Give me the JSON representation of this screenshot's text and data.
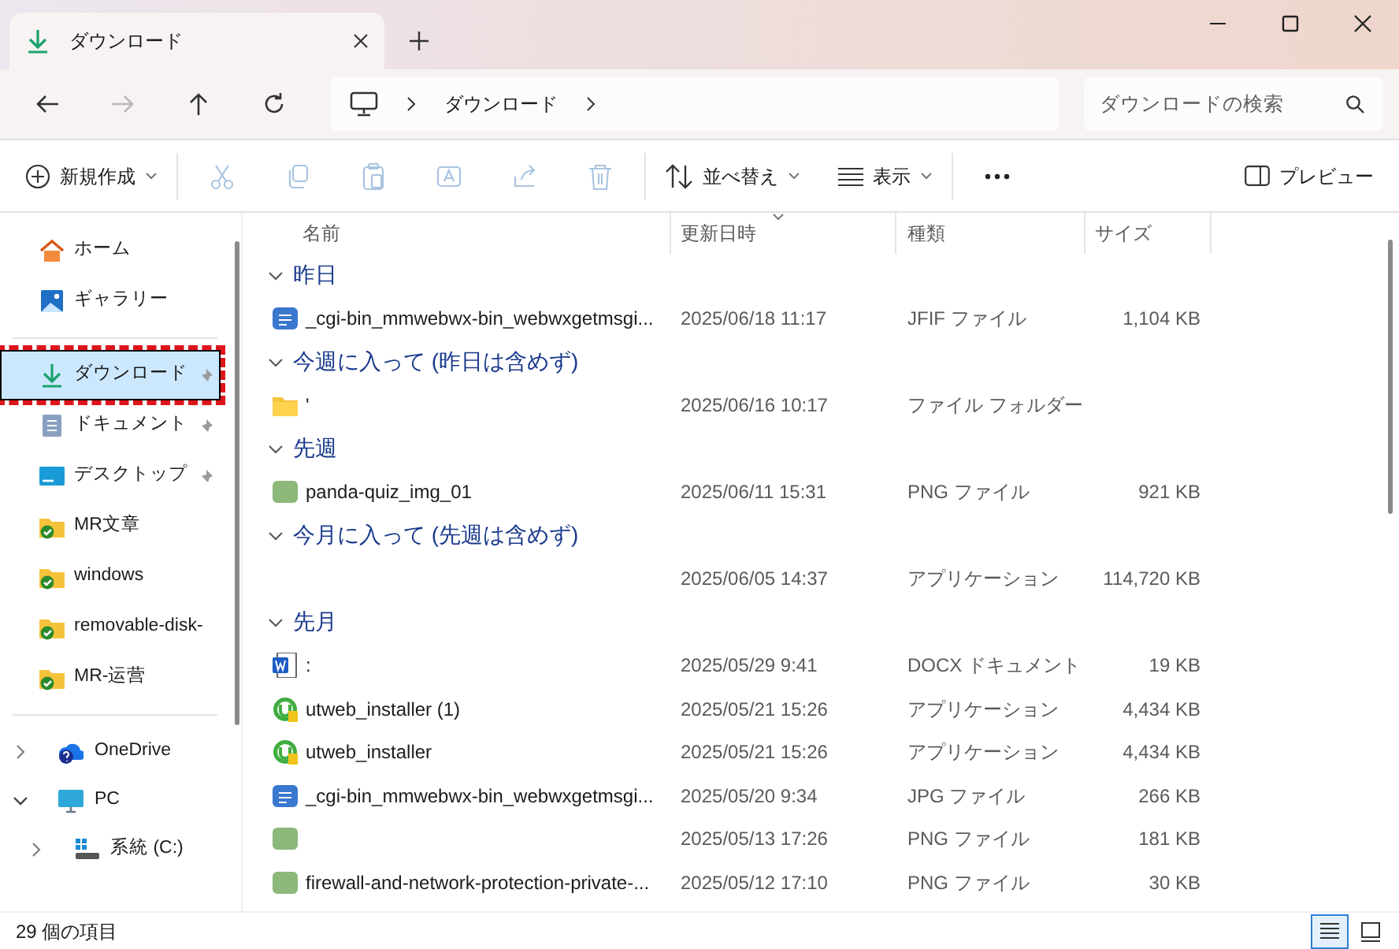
{
  "window": {
    "tab_title": "ダウンロード"
  },
  "address": {
    "crumbs": [
      "ダウンロード"
    ],
    "search_placeholder": "ダウンロードの検索"
  },
  "nav": [
    {
      "kind": "back",
      "disabled": false
    },
    {
      "kind": "forward",
      "disabled": true
    },
    {
      "kind": "up",
      "disabled": false
    },
    {
      "kind": "refresh",
      "disabled": false
    }
  ],
  "toolbar": {
    "new": "新規作成",
    "edit_tools": [
      {
        "kind": "cut",
        "disabled": true
      },
      {
        "kind": "copy",
        "disabled": true
      },
      {
        "kind": "paste",
        "disabled": true
      },
      {
        "kind": "rename",
        "disabled": true
      },
      {
        "kind": "share",
        "disabled": true
      },
      {
        "kind": "delete",
        "disabled": true
      }
    ],
    "sort": "並べ替え",
    "view": "表示",
    "preview": "プレビュー"
  },
  "sidebar": {
    "top": [
      {
        "label": "ホーム",
        "kind": "home",
        "pinned": false,
        "selected": false,
        "highlighted": false
      },
      {
        "label": "ギャラリー",
        "kind": "gallery",
        "pinned": false,
        "selected": false,
        "highlighted": false
      }
    ],
    "quick": [
      {
        "label": "ダウンロード",
        "kind": "download",
        "pinned": true,
        "selected": true,
        "highlighted": true
      },
      {
        "label": "ドキュメント",
        "kind": "documents",
        "pinned": true,
        "selected": false,
        "highlighted": false
      },
      {
        "label": "デスクトップ",
        "kind": "desktop",
        "pinned": true,
        "selected": false,
        "highlighted": false
      },
      {
        "label": "MR文章",
        "kind": "synced-folder",
        "pinned": false,
        "selected": false,
        "highlighted": false
      },
      {
        "label": "windows",
        "kind": "synced-folder",
        "pinned": false,
        "selected": false,
        "highlighted": false
      },
      {
        "label": "removable-disk-",
        "kind": "synced-folder",
        "pinned": false,
        "selected": false,
        "highlighted": false
      },
      {
        "label": "MR-运营",
        "kind": "synced-folder",
        "pinned": false,
        "selected": false,
        "highlighted": false
      }
    ],
    "tree": [
      {
        "label": "OneDrive",
        "kind": "onedrive",
        "expanded": false
      },
      {
        "label": "PC",
        "kind": "pc",
        "expanded": true,
        "children": [
          {
            "label": "系統 (C:)",
            "kind": "drive",
            "expanded": false
          }
        ]
      }
    ]
  },
  "table": {
    "columns": [
      {
        "label": "名前",
        "sorted": false
      },
      {
        "label": "更新日時",
        "sorted": true
      },
      {
        "label": "種類",
        "sorted": false
      },
      {
        "label": "サイズ",
        "sorted": false
      }
    ],
    "groups": [
      {
        "title": "昨日",
        "expanded": true,
        "rows": [
          {
            "kind": "jpg",
            "name": "_cgi-bin_mmwebwx-bin_webwxgetmsgi...",
            "date": "2025/06/18 11:17",
            "type": "JFIF ファイル",
            "size": "1,104 KB"
          }
        ]
      },
      {
        "title": "今週に入って (昨日は含めず)",
        "expanded": true,
        "rows": [
          {
            "kind": "folder",
            "name": "'",
            "date": "2025/06/16 10:17",
            "type": "ファイル フォルダー"
          }
        ]
      },
      {
        "title": "先週",
        "expanded": true,
        "rows": [
          {
            "kind": "png",
            "name": "panda-quiz_img_01",
            "date": "2025/06/11 15:31",
            "type": "PNG ファイル",
            "size": "921 KB"
          }
        ]
      },
      {
        "title": "今月に入って (先週は含めず)",
        "expanded": true,
        "rows": [
          {
            "kind": "blank",
            "date": "2025/06/05 14:37",
            "type": "アプリケーション",
            "size": "114,720 KB"
          }
        ]
      },
      {
        "title": "先月",
        "expanded": true,
        "rows": [
          {
            "kind": "docx",
            "name": ":",
            "date": "2025/05/29 9:41",
            "type": "DOCX ドキュメント",
            "size": "19 KB"
          },
          {
            "kind": "app",
            "name": "utweb_installer (1)",
            "date": "2025/05/21 15:26",
            "type": "アプリケーション",
            "size": "4,434 KB"
          },
          {
            "kind": "app",
            "name": "utweb_installer",
            "date": "2025/05/21 15:26",
            "type": "アプリケーション",
            "size": "4,434 KB"
          },
          {
            "kind": "jpg",
            "name": "_cgi-bin_mmwebwx-bin_webwxgetmsgi...",
            "date": "2025/05/20 9:34",
            "type": "JPG ファイル",
            "size": "266 KB"
          },
          {
            "kind": "png",
            "date": "2025/05/13 17:26",
            "type": "PNG ファイル",
            "size": "181 KB"
          },
          {
            "kind": "png",
            "name": "firewall-and-network-protection-private-...",
            "date": "2025/05/12 17:10",
            "type": "PNG ファイル",
            "size": "30 KB"
          }
        ]
      }
    ]
  },
  "status_bar": {
    "count": "29 個の項目",
    "views": [
      {
        "kind": "details",
        "selected": true
      },
      {
        "kind": "tiles",
        "selected": false
      }
    ]
  }
}
